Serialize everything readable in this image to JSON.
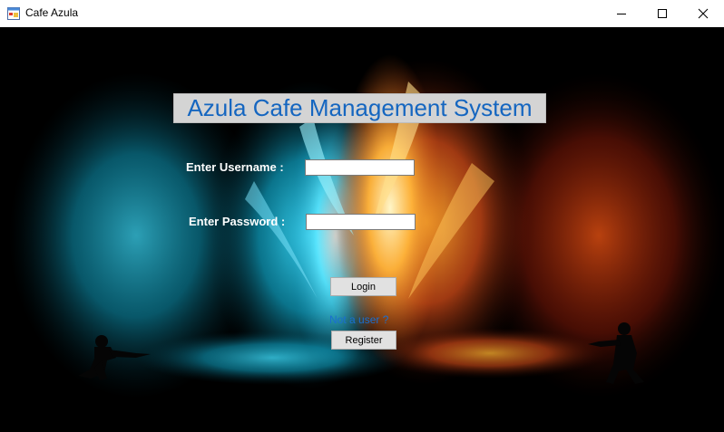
{
  "window": {
    "title": "Cafe Azula",
    "icons": {
      "app": "app-form-icon",
      "minimize": "minimize-icon",
      "maximize": "maximize-icon",
      "close": "close-icon"
    }
  },
  "form": {
    "heading": "Azula Cafe Management System",
    "username_label": "Enter Username :",
    "username_value": "",
    "password_label": "Enter Password :",
    "password_value": "",
    "login_label": "Login",
    "not_user_text": "Not a user ?",
    "register_label": "Register"
  },
  "colors": {
    "heading_text": "#1566c0",
    "heading_bg": "#d4d4d4",
    "link_text": "#1a6fd0",
    "fire_blue": "#22c8ff",
    "fire_orange": "#ff8a1c"
  }
}
